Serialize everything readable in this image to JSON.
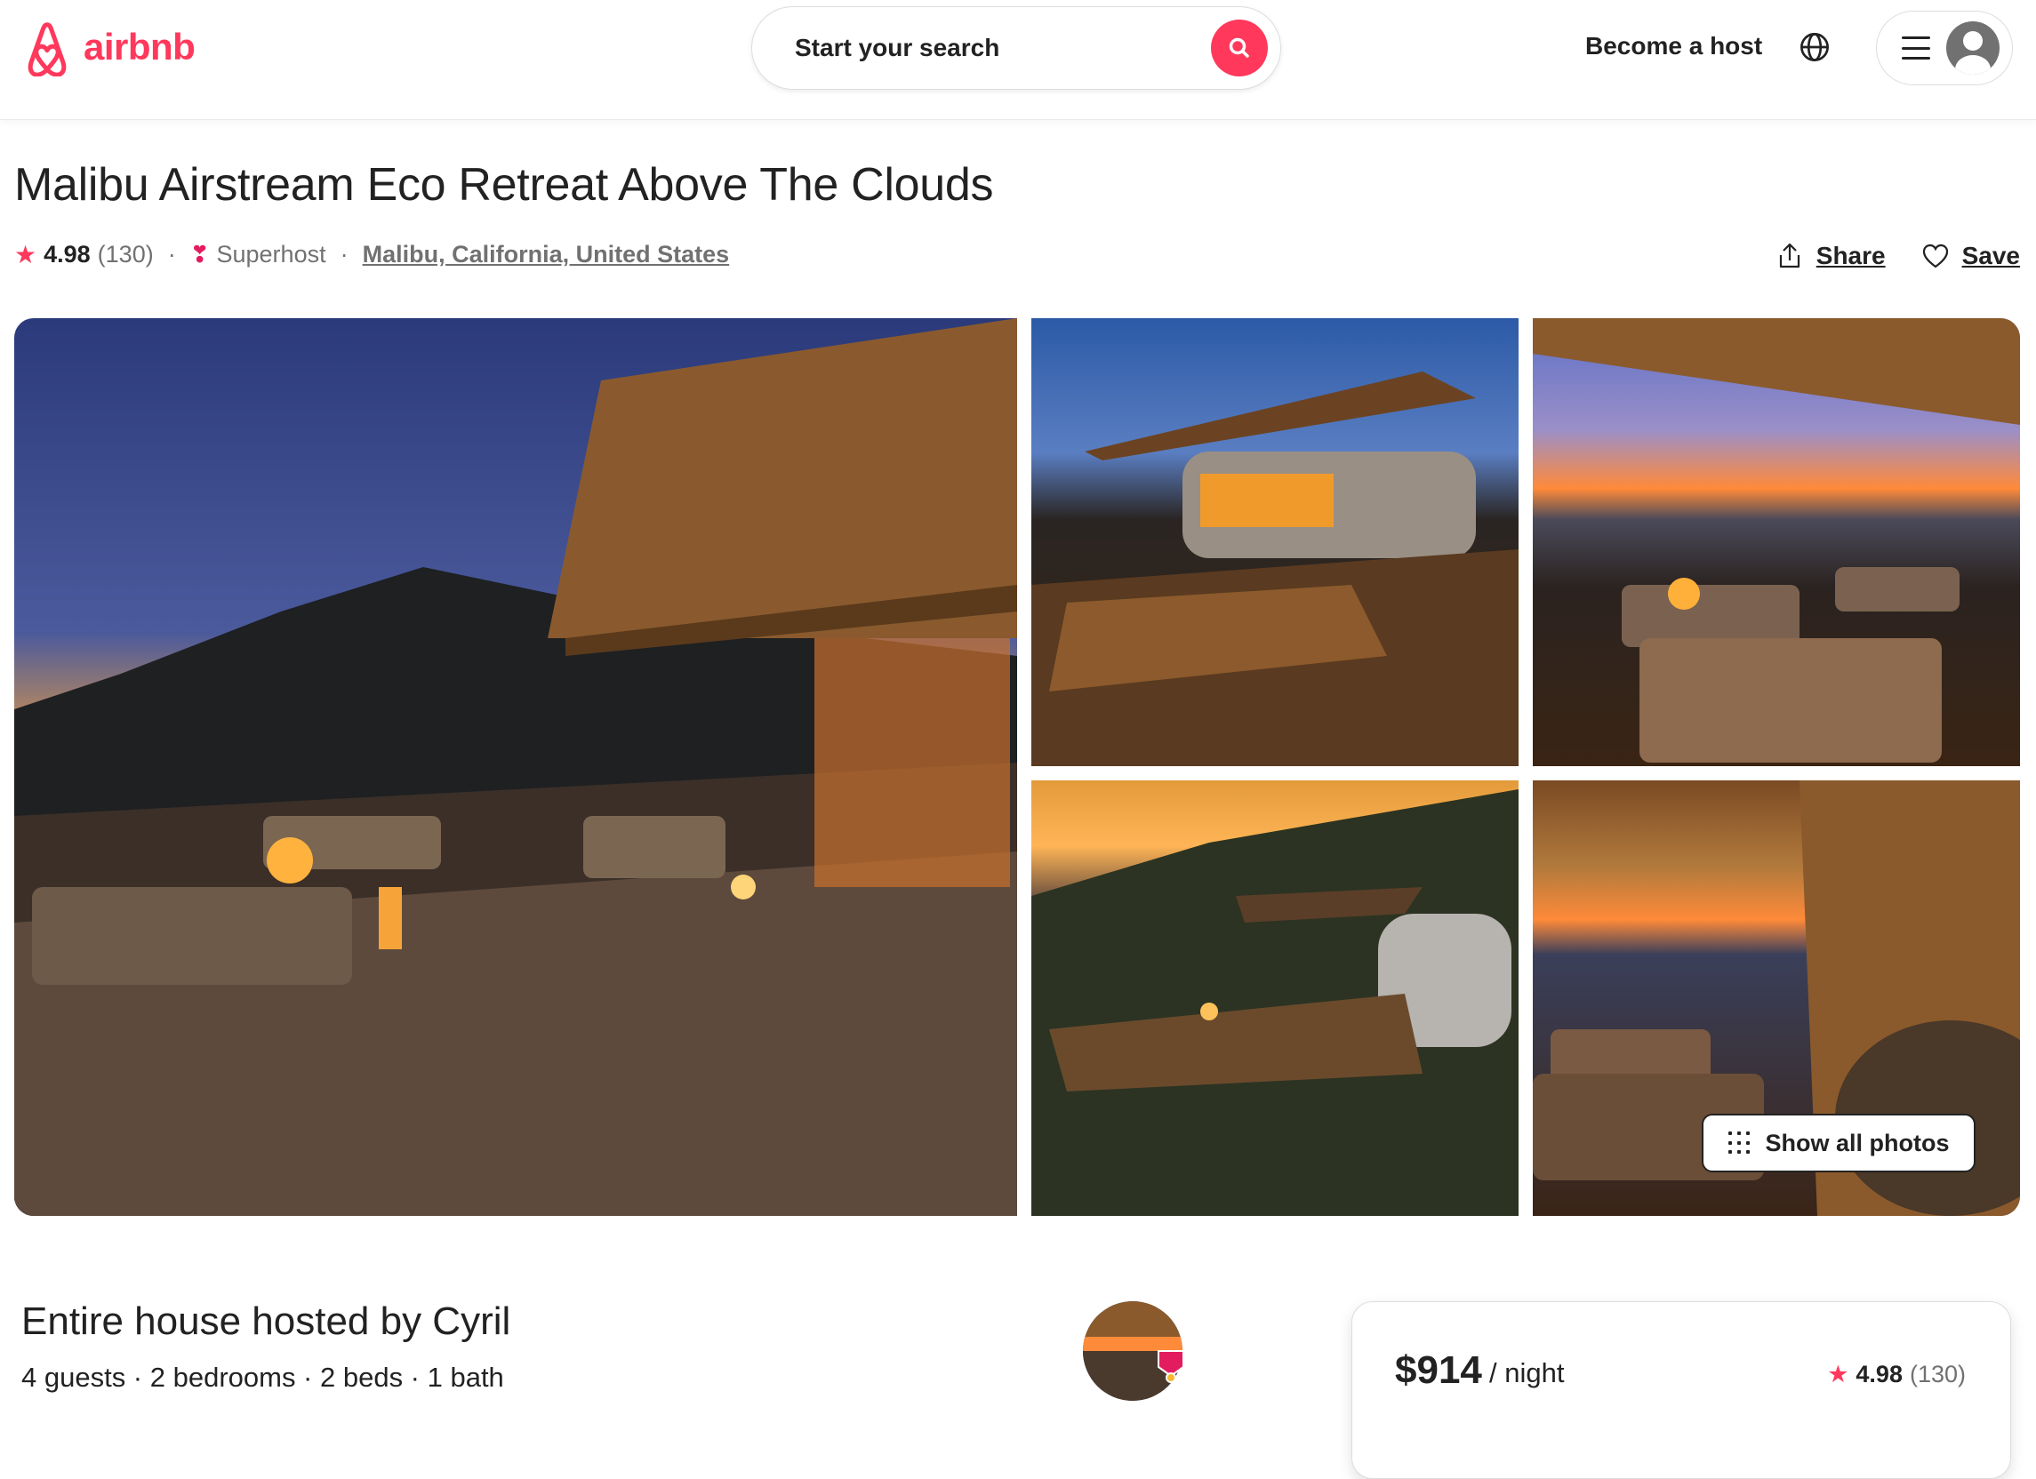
{
  "header": {
    "logo_text": "airbnb",
    "search_placeholder": "Start your search",
    "become_host": "Become a host",
    "icons": [
      "airbnb-logo-icon",
      "search-icon",
      "globe-icon",
      "menu-icon",
      "user-avatar-icon"
    ]
  },
  "listing": {
    "title": "Malibu Airstream Eco Retreat Above The Clouds",
    "rating": "4.98",
    "reviews": "(130)",
    "superhost": "Superhost",
    "location": "Malibu, California, United States",
    "share_label": "Share",
    "save_label": "Save",
    "separator": "·"
  },
  "gallery": {
    "show_all_label": "Show all photos",
    "photos": [
      "main-deck-sunset",
      "airstream-pergola",
      "firepit-ocean-view",
      "hillside-airstream",
      "interior-view"
    ]
  },
  "summary": {
    "hosted_by": "Entire house hosted by Cyril",
    "details": "4 guests · 2 bedrooms · 2 beds · 1 bath"
  },
  "booking": {
    "price": "$914",
    "per_night": "/ night",
    "rating": "4.98",
    "reviews": "(130)"
  },
  "colors": {
    "brand": "#FF385C",
    "text": "#222222",
    "muted": "#717171",
    "border": "#DDDDDD"
  }
}
